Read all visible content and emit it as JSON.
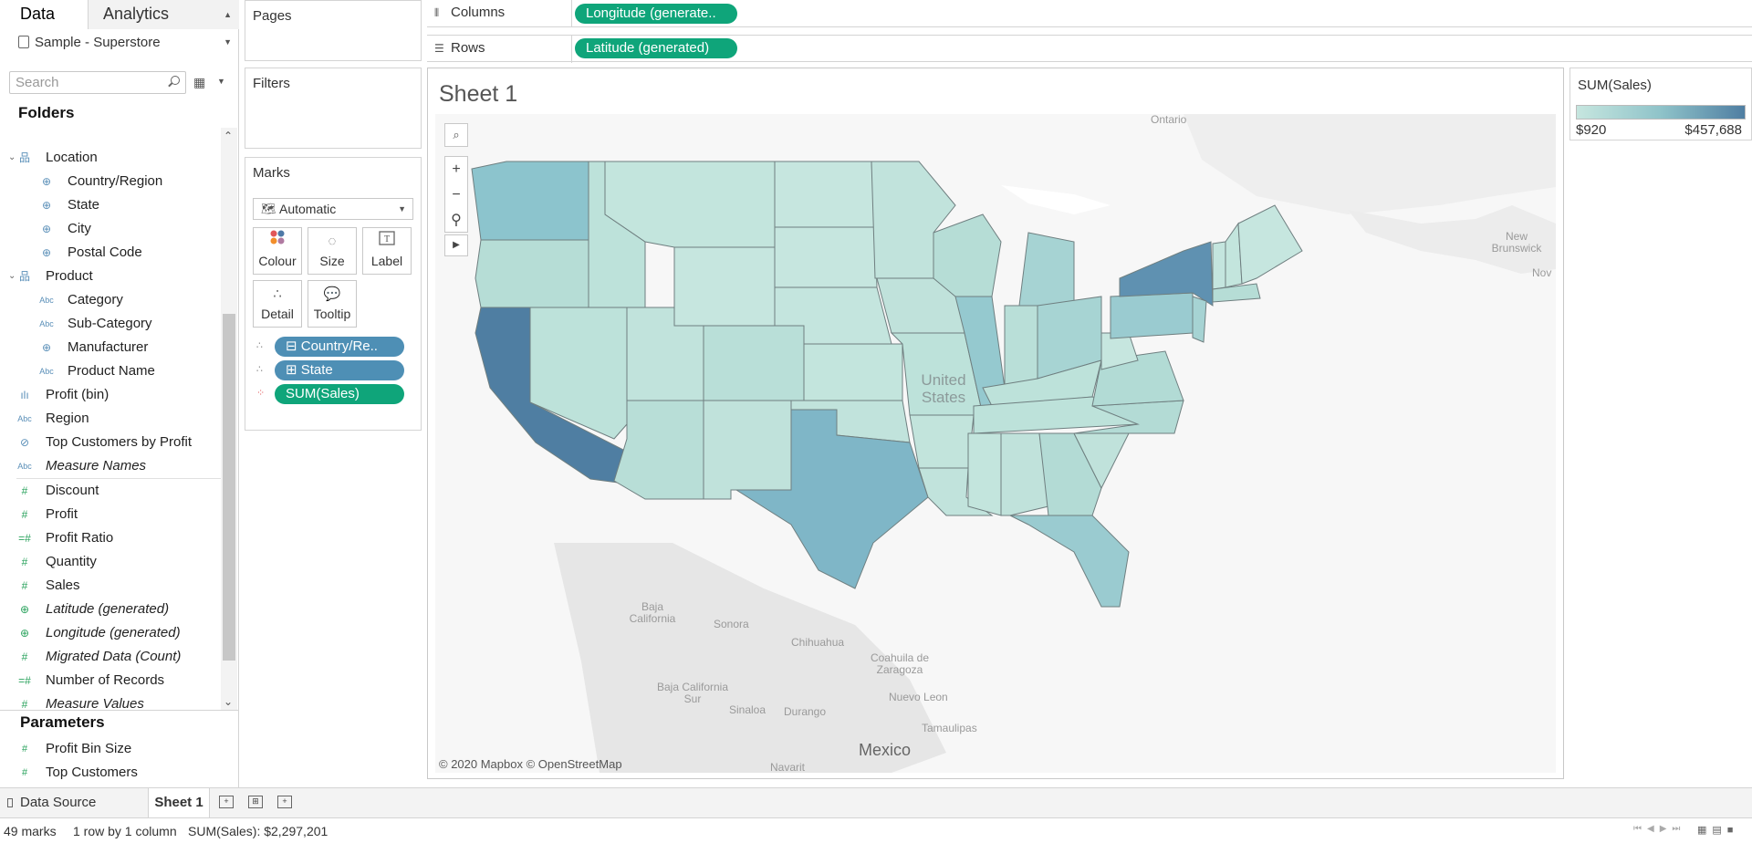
{
  "left_pane": {
    "tabs": {
      "data": "Data",
      "analytics": "Analytics"
    },
    "datasource": "Sample - Superstore",
    "search_placeholder": "Search",
    "folders_title": "Folders",
    "fields": [
      {
        "label": "Location",
        "icon": "hierarchy-icon",
        "level": 0,
        "caret": true
      },
      {
        "label": "Country/Region",
        "icon": "globe-icon",
        "level": 1
      },
      {
        "label": "State",
        "icon": "globe-icon",
        "level": 1
      },
      {
        "label": "City",
        "icon": "globe-icon",
        "level": 1
      },
      {
        "label": "Postal Code",
        "icon": "globe-icon",
        "level": 1
      },
      {
        "label": "Product",
        "icon": "hierarchy-icon",
        "level": 0,
        "caret": true
      },
      {
        "label": "Category",
        "icon": "abc-icon",
        "level": 1
      },
      {
        "label": "Sub-Category",
        "icon": "abc-icon",
        "level": 1
      },
      {
        "label": "Manufacturer",
        "icon": "globe-icon",
        "level": 1
      },
      {
        "label": "Product Name",
        "icon": "abc-icon",
        "level": 1
      },
      {
        "label": "Profit (bin)",
        "icon": "bin-icon",
        "level": 0
      },
      {
        "label": "Region",
        "icon": "abc-icon",
        "level": 0
      },
      {
        "label": "Top Customers by Profit",
        "icon": "set-icon",
        "level": 0
      },
      {
        "label": "Measure Names",
        "icon": "abc-icon",
        "level": 0,
        "italic": true
      },
      {
        "label": "Discount",
        "icon": "hash-icon",
        "level": 0,
        "measure": true
      },
      {
        "label": "Profit",
        "icon": "hash-icon",
        "level": 0,
        "measure": true
      },
      {
        "label": "Profit Ratio",
        "icon": "calc-hash-icon",
        "level": 0,
        "measure": true
      },
      {
        "label": "Quantity",
        "icon": "hash-icon",
        "level": 0,
        "measure": true
      },
      {
        "label": "Sales",
        "icon": "hash-icon",
        "level": 0,
        "measure": true
      },
      {
        "label": "Latitude (generated)",
        "icon": "globe-icon",
        "level": 0,
        "italic": true,
        "measure": true
      },
      {
        "label": "Longitude (generated)",
        "icon": "globe-icon",
        "level": 0,
        "italic": true,
        "measure": true
      },
      {
        "label": "Migrated Data (Count)",
        "icon": "hash-icon",
        "level": 0,
        "italic": true,
        "measure": true
      },
      {
        "label": "Number of Records",
        "icon": "calc-hash-icon",
        "level": 0,
        "measure": true
      },
      {
        "label": "Measure Values",
        "icon": "hash-icon",
        "level": 0,
        "italic": true,
        "measure": true
      }
    ],
    "params_title": "Parameters",
    "parameters": [
      "Profit Bin Size",
      "Top Customers"
    ]
  },
  "shelves": {
    "pages": "Pages",
    "filters": "Filters",
    "columns_label": "Columns",
    "columns_pill": "Longitude (generate..",
    "rows_label": "Rows",
    "rows_pill": "Latitude (generated)"
  },
  "marks": {
    "title": "Marks",
    "type": "Automatic",
    "buttons": {
      "colour": "Colour",
      "size": "Size",
      "label": "Label",
      "detail": "Detail",
      "tooltip": "Tooltip"
    },
    "pills": [
      "Country/Re..",
      "State",
      "SUM(Sales)"
    ]
  },
  "view": {
    "sheet_title": "Sheet 1",
    "credit": "© 2020 Mapbox © OpenStreetMap",
    "places": {
      "ontario": "Ontario",
      "new_brunswick": "New Brunswick",
      "nov": "Nov",
      "united_states": "United States",
      "baja_california": "Baja California",
      "sonora": "Sonora",
      "chihuahua": "Chihuahua",
      "coahuila": "Coahuila de Zaragoza",
      "baja_california_sur": "Baja California Sur",
      "sinaloa": "Sinaloa",
      "durango": "Durango",
      "nuevo_leon": "Nuevo Leon",
      "tamaulipas": "Tamaulipas",
      "mexico": "Mexico",
      "navarit": "Navarit"
    },
    "colors": {
      "low": "#c6e6df",
      "mid": "#8fc3c9",
      "high": "#4f7ea2"
    }
  },
  "legend": {
    "title": "SUM(Sales)",
    "min": "$920",
    "max": "$457,688"
  },
  "tabs": {
    "data_source": "Data Source",
    "sheet": "Sheet 1"
  },
  "status": {
    "marks": "49 marks",
    "dims": "1 row by 1 column",
    "sum": "SUM(Sales): $2,297,201"
  }
}
